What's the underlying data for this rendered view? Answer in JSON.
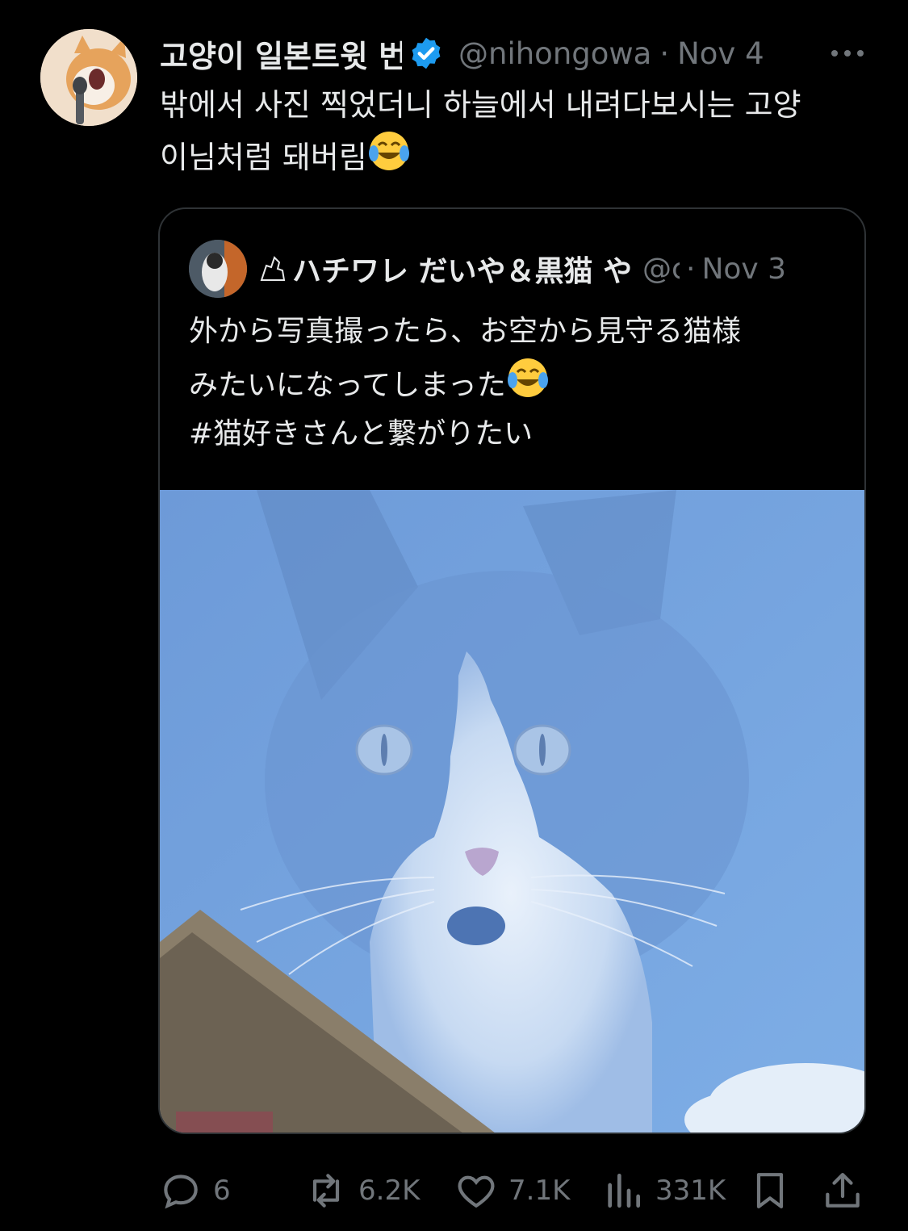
{
  "tweet": {
    "display_name": "고양이 일본트윗 번역",
    "handle": "@nihongowa",
    "separator": "·",
    "date": "Nov 4",
    "text_line1": "밖에서 사진 찍었더니 하늘에서 내려다보시는 고양",
    "text_line2": "이님처럼 돼버림",
    "emoji": "😂"
  },
  "quote": {
    "display_name": "ハチワレ だいや＆黒猫 や",
    "handle": "@c",
    "separator": "·",
    "date": "Nov 3",
    "text_line1": "外から写真撮ったら、お空から見守る猫様",
    "text_line2": "みたいになってしまった",
    "hashtag": "#猫好きさんと繋がりたい",
    "emoji": "😂"
  },
  "actions": {
    "replies": "6",
    "reposts": "6.2K",
    "likes": "7.1K",
    "views": "331K"
  },
  "colors": {
    "background": "#000000",
    "text": "#e7e9ea",
    "muted": "#71767b",
    "verified": "#1d9bf0",
    "border": "#2f3336",
    "sky": "#7aa7e0"
  },
  "icons": [
    "avatar",
    "verified-badge-icon",
    "more-icon",
    "dog-icon",
    "reply-icon",
    "repost-icon",
    "like-icon",
    "views-icon",
    "bookmark-icon",
    "share-icon"
  ]
}
